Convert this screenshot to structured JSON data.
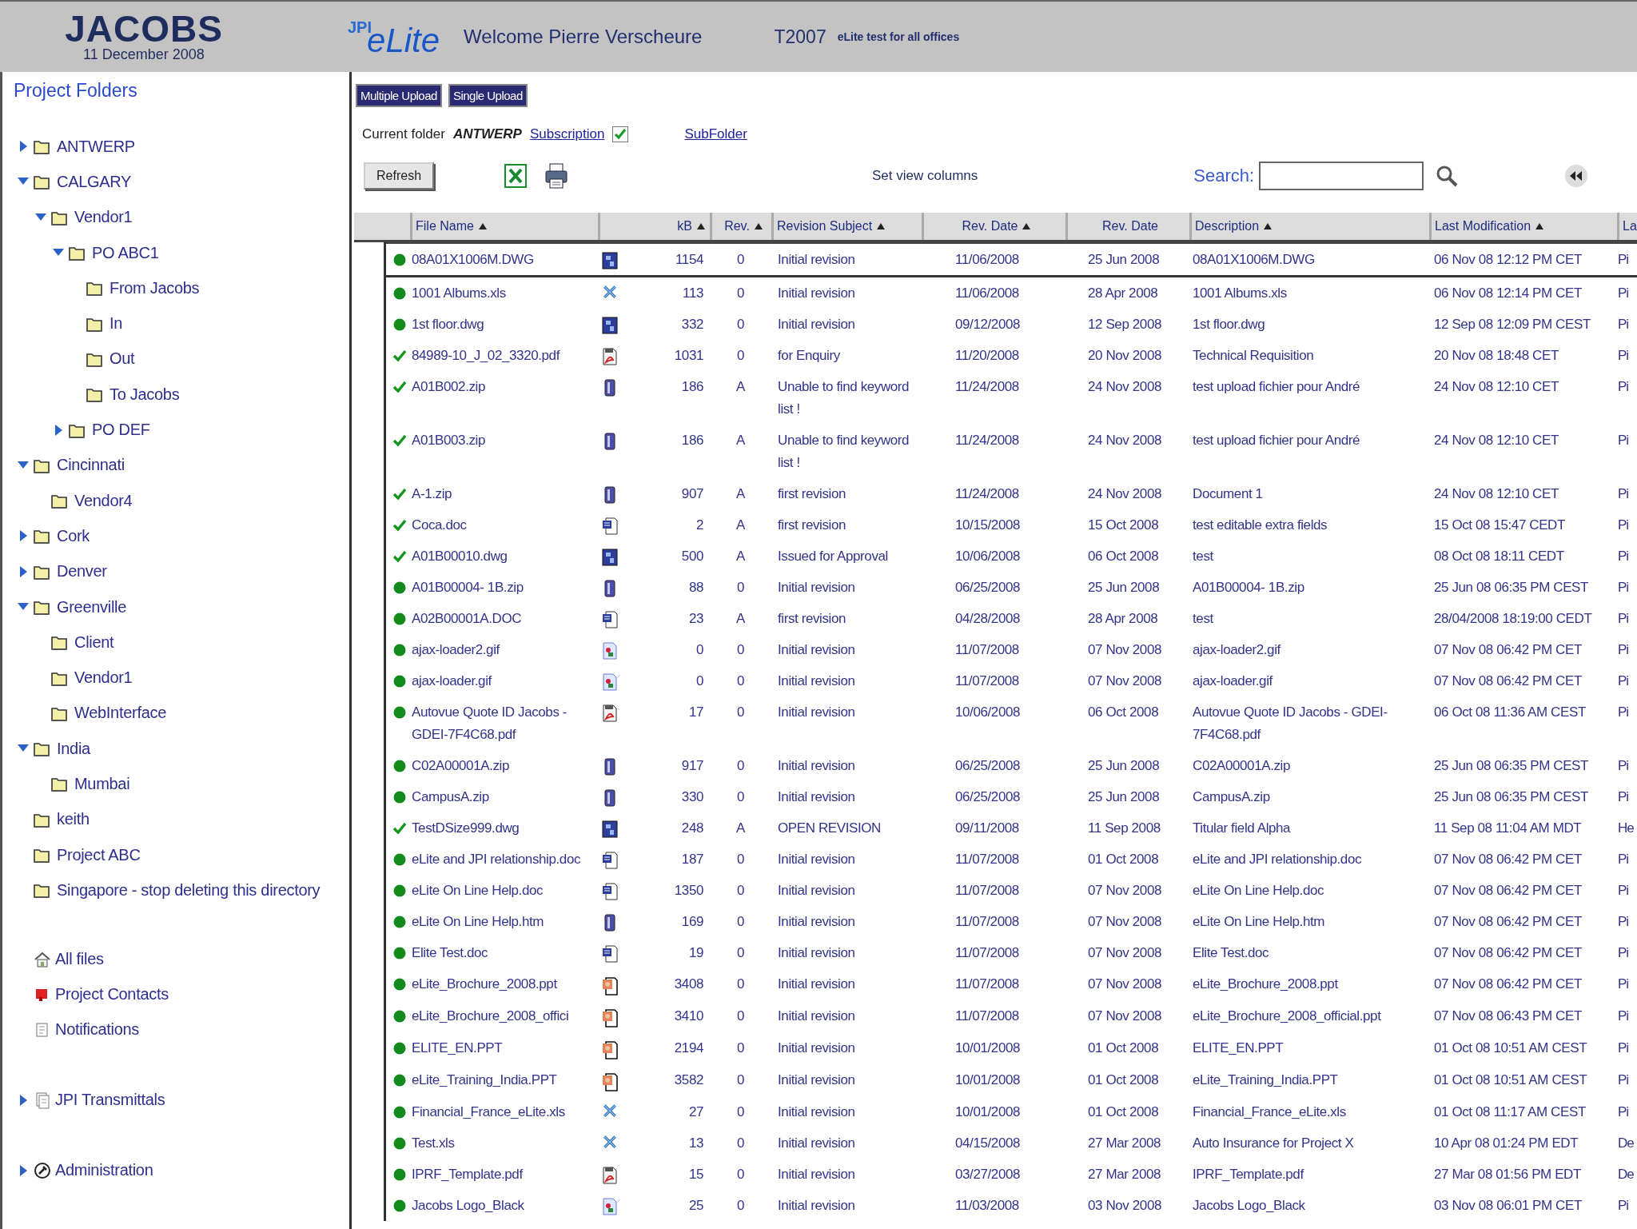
{
  "header": {
    "logo": "JACOBS",
    "date": "11 December 2008",
    "app_logo_prefix": "JPI",
    "app_logo": "eLite",
    "welcome": "Welcome Pierre Verscheure",
    "project_code": "T2007",
    "project_name": "eLite test for all offices"
  },
  "sidebar": {
    "title": "Project Folders",
    "folders": [
      {
        "label": "ANTWERP",
        "expandable": true,
        "expanded": false
      },
      {
        "label": "CALGARY",
        "expandable": true,
        "expanded": true,
        "children": [
          {
            "label": "Vendor1",
            "expandable": true,
            "expanded": true,
            "children": [
              {
                "label": "PO ABC1",
                "expandable": true,
                "expanded": true,
                "children": [
                  {
                    "label": "From Jacobs",
                    "expandable": false
                  },
                  {
                    "label": "In",
                    "expandable": false
                  },
                  {
                    "label": "Out",
                    "expandable": false
                  },
                  {
                    "label": "To Jacobs",
                    "expandable": false
                  }
                ]
              },
              {
                "label": "PO DEF",
                "expandable": true,
                "expanded": false
              }
            ]
          }
        ]
      },
      {
        "label": "Cincinnati",
        "expandable": true,
        "expanded": true,
        "children": [
          {
            "label": "Vendor4",
            "expandable": false
          }
        ]
      },
      {
        "label": "Cork",
        "expandable": true,
        "expanded": false
      },
      {
        "label": "Denver",
        "expandable": true,
        "expanded": false
      },
      {
        "label": "Greenville",
        "expandable": true,
        "expanded": true,
        "children": [
          {
            "label": "Client",
            "expandable": false
          },
          {
            "label": "Vendor1",
            "expandable": false
          },
          {
            "label": "WebInterface",
            "expandable": false
          }
        ]
      },
      {
        "label": "India",
        "expandable": true,
        "expanded": true,
        "children": [
          {
            "label": "Mumbai",
            "expandable": false
          }
        ]
      },
      {
        "label": "keith",
        "expandable": false
      },
      {
        "label": "Project ABC",
        "expandable": false
      },
      {
        "label": "Singapore - stop deleting this directory",
        "expandable": false
      }
    ],
    "links": [
      {
        "label": "All files",
        "kind": "all_files",
        "expandable": false
      },
      {
        "label": "Project Contacts",
        "kind": "contacts",
        "expandable": false
      },
      {
        "label": "Notifications",
        "kind": "notifications",
        "expandable": false
      }
    ],
    "more_links": [
      {
        "label": "JPI Transmittals",
        "kind": "transmittals",
        "expandable": true,
        "expanded": false
      },
      {
        "label": "Administration",
        "kind": "administration",
        "expandable": true,
        "expanded": false
      }
    ]
  },
  "toolbar": {
    "buttons": [
      "Multiple Upload",
      "Single Upload"
    ],
    "current_folder_label": "Current folder",
    "current_folder": "ANTWERP",
    "subscription_link": "Subscription",
    "subscribed": true,
    "subfolder_link": "SubFolder",
    "refresh": "Refresh",
    "view_columns_link": "Set view columns",
    "search_label": "Search:"
  },
  "table": {
    "columns": [
      {
        "label": "File Name",
        "sort_arrow": true
      },
      {
        "label": "kB",
        "sort_arrow": true
      },
      {
        "label": "Rev.",
        "sort_arrow": true
      },
      {
        "label": "Revision Subject",
        "sort_arrow": true
      },
      {
        "label": "Rev. Date",
        "sort_arrow": true
      },
      {
        "label": "Rev. Date",
        "sort_arrow": false
      },
      {
        "label": "Description",
        "sort_arrow": true
      },
      {
        "label": "Last Modification",
        "sort_arrow": true
      },
      {
        "label": "La"
      }
    ],
    "rows": [
      {
        "selected": true,
        "checked": false,
        "name": "08A01X1006M.DWG",
        "kind": "dwg",
        "kb": "1154",
        "rev": "0",
        "subject": "Initial revision",
        "rev_date": "11/06/2008",
        "rev_date_2": "25 Jun 2008",
        "description": "08A01X1006M.DWG",
        "last_modified": "06 Nov 08 12:12 PM CET",
        "column_10": "Pi"
      },
      {
        "selected": false,
        "checked": false,
        "name": "1001 Albums.xls",
        "kind": "xls",
        "kb": "113",
        "rev": "0",
        "subject": "Initial revision",
        "rev_date": "11/06/2008",
        "rev_date_2": "28 Apr 2008",
        "description": "1001 Albums.xls",
        "last_modified": "06 Nov 08 12:14 PM CET",
        "column_10": "Pi"
      },
      {
        "selected": false,
        "checked": false,
        "name": "1st floor.dwg",
        "kind": "dwg",
        "kb": "332",
        "rev": "0",
        "subject": "Initial revision",
        "rev_date": "09/12/2008",
        "rev_date_2": "12 Sep 2008",
        "description": "1st floor.dwg",
        "last_modified": "12 Sep 08 12:09 PM CEST",
        "column_10": "Pi"
      },
      {
        "selected": false,
        "checked": true,
        "name": "84989-10_J_02_3320.pdf",
        "kind": "pdf",
        "kb": "1031",
        "rev": "0",
        "subject": "for Enquiry",
        "rev_date": "11/20/2008",
        "rev_date_2": "20 Nov 2008",
        "description": "Technical Requisition",
        "last_modified": "20 Nov 08 18:48 CET",
        "column_10": "Pi"
      },
      {
        "selected": false,
        "checked": true,
        "name": "A01B002.zip",
        "kind": "zip",
        "kb": "186",
        "rev": "A",
        "subject": "Unable to find keyword list !",
        "rev_date": "11/24/2008",
        "rev_date_2": "24 Nov 2008",
        "description": "test upload fichier pour André",
        "last_modified": "24 Nov 08 12:10 CET",
        "column_10": "Pi"
      },
      {
        "selected": false,
        "checked": true,
        "name": "A01B003.zip",
        "kind": "zip",
        "kb": "186",
        "rev": "A",
        "subject": "Unable to find keyword list !",
        "rev_date": "11/24/2008",
        "rev_date_2": "24 Nov 2008",
        "description": "test upload fichier pour André",
        "last_modified": "24 Nov 08 12:10 CET",
        "column_10": "Pi"
      },
      {
        "selected": false,
        "checked": true,
        "name": "A-1.zip",
        "kind": "zip",
        "kb": "907",
        "rev": "A",
        "subject": "first revision",
        "rev_date": "11/24/2008",
        "rev_date_2": "24 Nov 2008",
        "description": "Document 1",
        "last_modified": "24 Nov 08 12:10 CET",
        "column_10": "Pi"
      },
      {
        "selected": false,
        "checked": true,
        "name": "Coca.doc",
        "kind": "doc",
        "kb": "2",
        "rev": "A",
        "subject": "first revision",
        "rev_date": "10/15/2008",
        "rev_date_2": "15 Oct 2008",
        "description": "test editable extra fields",
        "last_modified": "15 Oct 08 15:47 CEDT",
        "column_10": "Pi"
      },
      {
        "selected": false,
        "checked": true,
        "name": "A01B00010.dwg",
        "kind": "dwg",
        "kb": "500",
        "rev": "A",
        "subject": "Issued for Approval",
        "rev_date": "10/06/2008",
        "rev_date_2": "06 Oct 2008",
        "description": "test",
        "last_modified": "08 Oct 08 18:11 CEDT",
        "column_10": "Pi"
      },
      {
        "selected": false,
        "checked": false,
        "name": "A01B00004- 1B.zip",
        "kind": "zip",
        "kb": "88",
        "rev": "0",
        "subject": "Initial revision",
        "rev_date": "06/25/2008",
        "rev_date_2": "25 Jun 2008",
        "description": "A01B00004- 1B.zip",
        "last_modified": "25 Jun 08 06:35 PM CEST",
        "column_10": "Pi"
      },
      {
        "selected": false,
        "checked": false,
        "name": "A02B00001A.DOC",
        "kind": "doc",
        "kb": "23",
        "rev": "A",
        "subject": "first revision",
        "rev_date": "04/28/2008",
        "rev_date_2": "28 Apr 2008",
        "description": "test",
        "last_modified": "28/04/2008 18:19:00 CEDT",
        "column_10": "Pi"
      },
      {
        "selected": false,
        "checked": false,
        "name": "ajax-loader2.gif",
        "kind": "gif",
        "kb": "0",
        "rev": "0",
        "subject": "Initial revision",
        "rev_date": "11/07/2008",
        "rev_date_2": "07 Nov 2008",
        "description": "ajax-loader2.gif",
        "last_modified": "07 Nov 08 06:42 PM CET",
        "column_10": "Pi"
      },
      {
        "selected": false,
        "checked": false,
        "name": "ajax-loader.gif",
        "kind": "gif",
        "kb": "0",
        "rev": "0",
        "subject": "Initial revision",
        "rev_date": "11/07/2008",
        "rev_date_2": "07 Nov 2008",
        "description": "ajax-loader.gif",
        "last_modified": "07 Nov 08 06:42 PM CET",
        "column_10": "Pi"
      },
      {
        "selected": false,
        "checked": false,
        "name": "Autovue Quote ID Jacobs - GDEI-7F4C68.pdf",
        "kind": "pdf",
        "kb": "17",
        "rev": "0",
        "subject": "Initial revision",
        "rev_date": "10/06/2008",
        "rev_date_2": "06 Oct 2008",
        "description": "Autovue Quote ID Jacobs - GDEI-7F4C68.pdf",
        "last_modified": "06 Oct 08 11:36 AM CEST",
        "column_10": "Pi"
      },
      {
        "selected": false,
        "checked": false,
        "name": "C02A00001A.zip",
        "kind": "zip",
        "kb": "917",
        "rev": "0",
        "subject": "Initial revision",
        "rev_date": "06/25/2008",
        "rev_date_2": "25 Jun 2008",
        "description": "C02A00001A.zip",
        "last_modified": "25 Jun 08 06:35 PM CEST",
        "column_10": "Pi"
      },
      {
        "selected": false,
        "checked": false,
        "name": "CampusA.zip",
        "kind": "zip",
        "kb": "330",
        "rev": "0",
        "subject": "Initial revision",
        "rev_date": "06/25/2008",
        "rev_date_2": "25 Jun 2008",
        "description": "CampusA.zip",
        "last_modified": "25 Jun 08 06:35 PM CEST",
        "column_10": "Pi"
      },
      {
        "selected": false,
        "checked": true,
        "name": "TestDSize999.dwg",
        "kind": "dwg",
        "kb": "248",
        "rev": "A",
        "subject": "OPEN REVISION",
        "rev_date": "09/11/2008",
        "rev_date_2": "11 Sep 2008",
        "description": "Titular field Alpha",
        "last_modified": "11 Sep 08 11:04 AM MDT",
        "column_10": "He"
      },
      {
        "selected": false,
        "checked": false,
        "name": "eLite and JPI relationship.doc",
        "kind": "doc",
        "kb": "187",
        "rev": "0",
        "subject": "Initial revision",
        "rev_date": "11/07/2008",
        "rev_date_2": "01 Oct 2008",
        "description": "eLite and JPI relationship.doc",
        "last_modified": "07 Nov 08 06:42 PM CET",
        "column_10": "Pi"
      },
      {
        "selected": false,
        "checked": false,
        "name": "eLite On Line Help.doc",
        "kind": "doc",
        "kb": "1350",
        "rev": "0",
        "subject": "Initial revision",
        "rev_date": "11/07/2008",
        "rev_date_2": "07 Nov 2008",
        "description": "eLite On Line Help.doc",
        "last_modified": "07 Nov 08 06:42 PM CET",
        "column_10": "Pi"
      },
      {
        "selected": false,
        "checked": false,
        "name": "eLite On Line Help.htm",
        "kind": "zip",
        "kb": "169",
        "rev": "0",
        "subject": "Initial revision",
        "rev_date": "11/07/2008",
        "rev_date_2": "07 Nov 2008",
        "description": "eLite On Line Help.htm",
        "last_modified": "07 Nov 08 06:42 PM CET",
        "column_10": "Pi"
      },
      {
        "selected": false,
        "checked": false,
        "name": "Elite Test.doc",
        "kind": "doc",
        "kb": "19",
        "rev": "0",
        "subject": "Initial revision",
        "rev_date": "11/07/2008",
        "rev_date_2": "07 Nov 2008",
        "description": "Elite Test.doc",
        "last_modified": "07 Nov 08 06:42 PM CET",
        "column_10": "Pi"
      },
      {
        "selected": false,
        "checked": false,
        "name": "eLite_Brochure_2008.ppt",
        "kind": "ppt",
        "kb": "3408",
        "rev": "0",
        "subject": "Initial revision",
        "rev_date": "11/07/2008",
        "rev_date_2": "07 Nov 2008",
        "description": "eLite_Brochure_2008.ppt",
        "last_modified": "07 Nov 08 06:42 PM CET",
        "column_10": "Pi"
      },
      {
        "selected": false,
        "checked": false,
        "name": "eLite_Brochure_2008_offici",
        "kind": "ppt",
        "kb": "3410",
        "rev": "0",
        "subject": "Initial revision",
        "rev_date": "11/07/2008",
        "rev_date_2": "07 Nov 2008",
        "description": "eLite_Brochure_2008_official.ppt",
        "last_modified": "07 Nov 08 06:43 PM CET",
        "column_10": "Pi"
      },
      {
        "selected": false,
        "checked": false,
        "name": "ELITE_EN.PPT",
        "kind": "ppt",
        "kb": "2194",
        "rev": "0",
        "subject": "Initial revision",
        "rev_date": "10/01/2008",
        "rev_date_2": "01 Oct 2008",
        "description": "ELITE_EN.PPT",
        "last_modified": "01 Oct 08 10:51 AM CEST",
        "column_10": "Pi"
      },
      {
        "selected": false,
        "checked": false,
        "name": "eLite_Training_India.PPT",
        "kind": "ppt",
        "kb": "3582",
        "rev": "0",
        "subject": "Initial revision",
        "rev_date": "10/01/2008",
        "rev_date_2": "01 Oct 2008",
        "description": "eLite_Training_India.PPT",
        "last_modified": "01 Oct 08 10:51 AM CEST",
        "column_10": "Pi"
      },
      {
        "selected": false,
        "checked": false,
        "name": "Financial_France_eLite.xls",
        "kind": "xls",
        "kb": "27",
        "rev": "0",
        "subject": "Initial revision",
        "rev_date": "10/01/2008",
        "rev_date_2": "01 Oct 2008",
        "description": "Financial_France_eLite.xls",
        "last_modified": "01 Oct 08 11:17 AM CEST",
        "column_10": "Pi"
      },
      {
        "selected": false,
        "checked": false,
        "name": "Test.xls",
        "kind": "xls",
        "kb": "13",
        "rev": "0",
        "subject": "Initial revision",
        "rev_date": "04/15/2008",
        "rev_date_2": "27 Mar 2008",
        "description": "Auto Insurance for Project X",
        "last_modified": "10 Apr 08 01:24 PM EDT",
        "column_10": "De"
      },
      {
        "selected": false,
        "checked": false,
        "name": "IPRF_Template.pdf",
        "kind": "pdf",
        "kb": "15",
        "rev": "0",
        "subject": "Initial revision",
        "rev_date": "03/27/2008",
        "rev_date_2": "27 Mar 2008",
        "description": "IPRF_Template.pdf",
        "last_modified": "27 Mar 08 01:56 PM EDT",
        "column_10": "De"
      },
      {
        "selected": false,
        "checked": false,
        "name": "Jacobs Logo_Black",
        "kind": "gif",
        "kb": "25",
        "rev": "0",
        "subject": "Initial revision",
        "rev_date": "11/03/2008",
        "rev_date_2": "03 Nov 2008",
        "description": "Jacobs Logo_Black",
        "last_modified": "03 Nov 08 06:01 PM CET",
        "column_10": "Pi"
      }
    ]
  }
}
